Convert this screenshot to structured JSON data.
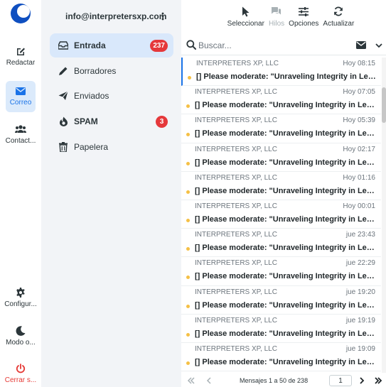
{
  "rail": {
    "items": [
      {
        "name": "compose",
        "label": "Redactar"
      },
      {
        "name": "mail",
        "label": "Correo"
      },
      {
        "name": "contacts",
        "label": "Contact..."
      },
      {
        "name": "settings",
        "label": "Configur..."
      },
      {
        "name": "dark-mode",
        "label": "Modo o..."
      },
      {
        "name": "logout",
        "label": "Cerrar s..."
      }
    ]
  },
  "account": {
    "email": "info@interpretersxp.com"
  },
  "folders": [
    {
      "name": "Entrada",
      "badge": "237"
    },
    {
      "name": "Borradores",
      "badge": ""
    },
    {
      "name": "Enviados",
      "badge": ""
    },
    {
      "name": "SPAM",
      "badge": "3"
    },
    {
      "name": "Papelera",
      "badge": ""
    }
  ],
  "toolbar": {
    "select": "Seleccionar",
    "threads": "Hilos",
    "options": "Opciones",
    "refresh": "Actualizar"
  },
  "search": {
    "placeholder": "Buscar..."
  },
  "messages": [
    {
      "from": "INTERPRETERS XP, LLC",
      "date": "Hoy 08:15",
      "subject": "[] Please moderate: \"Unraveling Integrity in Legal..."
    },
    {
      "from": "INTERPRETERS XP, LLC",
      "date": "Hoy 07:05",
      "subject": "[] Please moderate: \"Unraveling Integrity in Legal..."
    },
    {
      "from": "INTERPRETERS XP, LLC",
      "date": "Hoy 05:39",
      "subject": "[] Please moderate: \"Unraveling Integrity in Legal..."
    },
    {
      "from": "INTERPRETERS XP, LLC",
      "date": "Hoy 02:17",
      "subject": "[] Please moderate: \"Unraveling Integrity in Legal..."
    },
    {
      "from": "INTERPRETERS XP, LLC",
      "date": "Hoy 01:16",
      "subject": "[] Please moderate: \"Unraveling Integrity in Legal..."
    },
    {
      "from": "INTERPRETERS XP, LLC",
      "date": "Hoy 00:01",
      "subject": "[] Please moderate: \"Unraveling Integrity in Legal..."
    },
    {
      "from": "INTERPRETERS XP, LLC",
      "date": "jue 23:43",
      "subject": "[] Please moderate: \"Unraveling Integrity in Legal..."
    },
    {
      "from": "INTERPRETERS XP, LLC",
      "date": "jue 22:29",
      "subject": "[] Please moderate: \"Unraveling Integrity in Legal..."
    },
    {
      "from": "INTERPRETERS XP, LLC",
      "date": "jue 19:20",
      "subject": "[] Please moderate: \"Unraveling Integrity in Legal..."
    },
    {
      "from": "INTERPRETERS XP, LLC",
      "date": "jue 19:19",
      "subject": "[] Please moderate: \"Unraveling Integrity in Legal..."
    },
    {
      "from": "INTERPRETERS XP, LLC",
      "date": "jue 19:09",
      "subject": "[] Please moderate: \"Unraveling Integrity in Legal..."
    }
  ],
  "pager": {
    "count": "Mensajes 1 a 50 de 238",
    "page": "1"
  },
  "colors": {
    "accent": "#1a73e8",
    "badge": "#e5383b",
    "active_bg": "#d9e8fb",
    "unread_dot": "#f5c045"
  }
}
